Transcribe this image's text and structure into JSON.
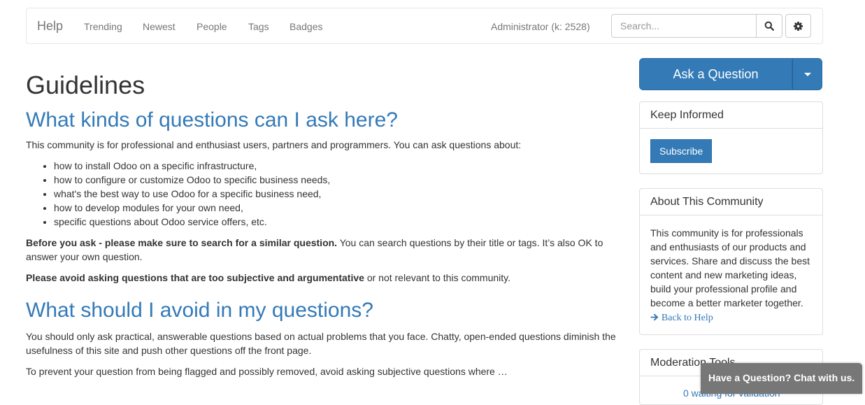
{
  "navbar": {
    "brand": "Help",
    "links": [
      "Trending",
      "Newest",
      "People",
      "Tags",
      "Badges"
    ],
    "user": "Administrator (k: 2528)",
    "search_placeholder": "Search..."
  },
  "main": {
    "title": "Guidelines",
    "section1": {
      "heading": "What kinds of questions can I ask here?",
      "intro": "This community is for professional and enthusiast users, partners and programmers. You can ask questions about:",
      "items": [
        "how to install Odoo on a specific infrastructure,",
        "how to configure or customize Odoo to specific business needs,",
        "what's the best way to use Odoo for a specific business need,",
        "how to develop modules for your own need,",
        "specific questions about Odoo service offers, etc."
      ],
      "before_bold": "Before you ask - please make sure to search for a similar question.",
      "before_text": " You can search questions by their title or tags. It’s also OK to answer your own question.",
      "avoid_bold": "Please avoid asking questions that are too subjective and argumentative",
      "avoid_text": " or not relevant to this community."
    },
    "section2": {
      "heading": "What should I avoid in my questions?",
      "p1": "You should only ask practical, answerable questions based on actual problems that you face. Chatty, open-ended questions diminish the usefulness of this site and push other questions off the front page.",
      "p2": "To prevent your question from being flagged and possibly removed, avoid asking subjective questions where …"
    }
  },
  "sidebar": {
    "ask_button": "Ask a Question",
    "keep_informed": {
      "heading": "Keep Informed",
      "subscribe": "Subscribe"
    },
    "about": {
      "heading": "About This Community",
      "text": "This community is for professionals and enthusiasts of our products and services. Share and discuss the best content and new marketing ideas, build your professional profile and become a better marketer together.",
      "back_link": "Back to Help"
    },
    "moderation": {
      "heading": "Moderation Tools",
      "partial_text": "0 waiting for validation"
    }
  },
  "chat": {
    "label": "Have a Question? Chat with us."
  },
  "colors": {
    "primary": "#337ab7",
    "nav_text": "#777777",
    "chat_bg": "#777777"
  }
}
